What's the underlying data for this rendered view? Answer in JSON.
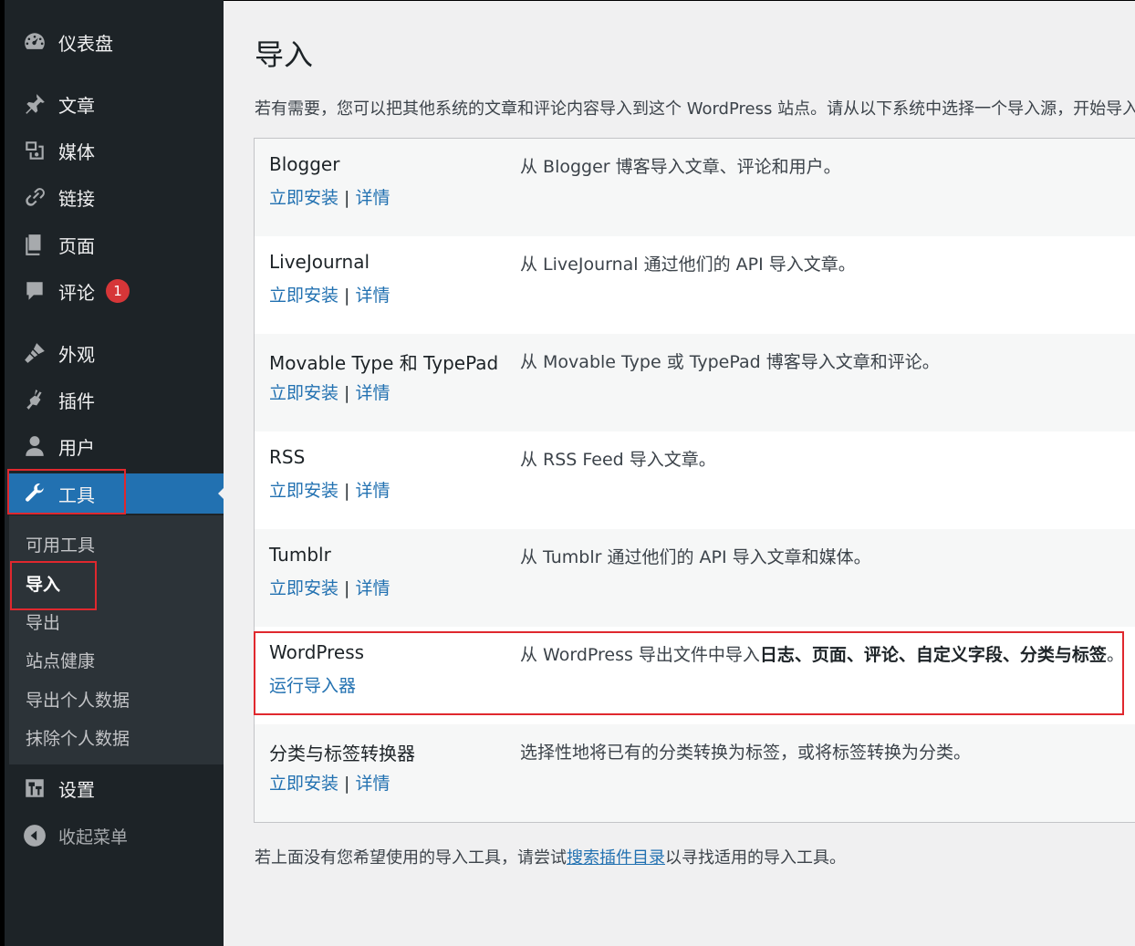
{
  "sidebar": {
    "items": [
      {
        "label": "仪表盘",
        "icon": "dashboard-icon"
      },
      {
        "label": "文章",
        "icon": "pin-icon"
      },
      {
        "label": "媒体",
        "icon": "media-icon"
      },
      {
        "label": "链接",
        "icon": "link-icon"
      },
      {
        "label": "页面",
        "icon": "page-icon"
      },
      {
        "label": "评论",
        "icon": "comment-icon",
        "badge": "1"
      },
      {
        "label": "外观",
        "icon": "brush-icon"
      },
      {
        "label": "插件",
        "icon": "plugin-icon"
      },
      {
        "label": "用户",
        "icon": "user-icon"
      },
      {
        "label": "工具",
        "icon": "wrench-icon"
      },
      {
        "label": "设置",
        "icon": "settings-icon"
      }
    ],
    "submenu": [
      "可用工具",
      "导入",
      "导出",
      "站点健康",
      "导出个人数据",
      "抹除个人数据"
    ],
    "collapse_label": "收起菜单"
  },
  "main": {
    "title": "导入",
    "intro": "若有需要，您可以把其他系统的文章和评论内容导入到这个 WordPress 站点。请从以下系统中选择一个导入源，开始导入。",
    "install_label": "立即安装",
    "details_label": "详情",
    "separator": " | ",
    "run_label": "运行导入器",
    "importers": [
      {
        "name": "Blogger",
        "desc": "从 Blogger 博客导入文章、评论和用户。"
      },
      {
        "name": "LiveJournal",
        "desc": "从 LiveJournal 通过他们的 API 导入文章。"
      },
      {
        "name": "Movable Type 和 TypePad",
        "desc": "从 Movable Type 或 TypePad 博客导入文章和评论。"
      },
      {
        "name": "RSS",
        "desc": "从 RSS Feed 导入文章。"
      },
      {
        "name": "Tumblr",
        "desc": "从 Tumblr 通过他们的 API 导入文章和媒体。"
      },
      {
        "name": "WordPress",
        "desc_prefix": "从 WordPress 导出文件中导入",
        "desc_bold": "日志、页面、评论、自定义字段、分类与标签",
        "desc_suffix": "。"
      },
      {
        "name": "分类与标签转换器",
        "desc": "选择性地将已有的分类转换为标签，或将标签转换为分类。"
      }
    ],
    "footer_prefix": "若上面没有您希望使用的导入工具，请尝试",
    "footer_link": "搜索插件目录",
    "footer_suffix": "以寻找适用的导入工具。"
  },
  "colors": {
    "sidebar_bg": "#1d2327",
    "active_bg": "#2271b1",
    "link": "#2271b1",
    "badge": "#d63638",
    "highlight": "#e0282e"
  }
}
